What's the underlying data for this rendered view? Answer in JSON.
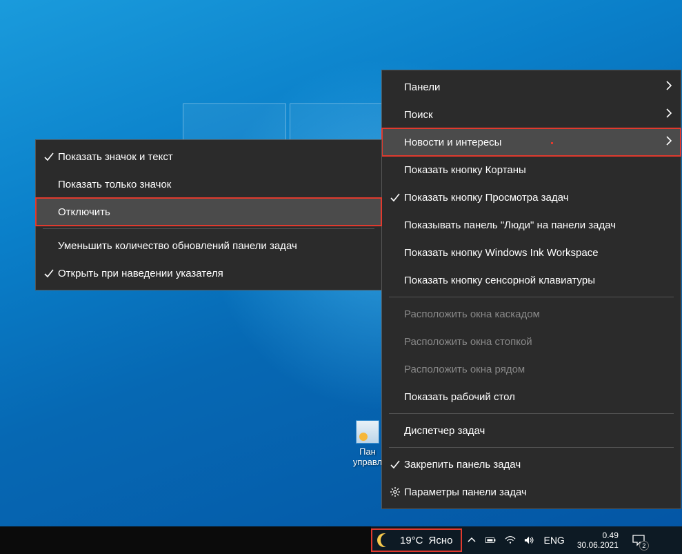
{
  "desktop": {
    "icon_label_line1": "Пан",
    "icon_label_line2": "управл"
  },
  "main_menu": {
    "items": [
      {
        "label": "Панели",
        "submenu": true,
        "checked": false,
        "gear": false,
        "disabled": false,
        "highlighted": false
      },
      {
        "label": "Поиск",
        "submenu": true,
        "checked": false,
        "gear": false,
        "disabled": false,
        "highlighted": false
      },
      {
        "label": "Новости и интересы",
        "submenu": true,
        "checked": false,
        "gear": false,
        "disabled": false,
        "highlighted": true
      },
      {
        "label": "Показать кнопку Кортаны",
        "submenu": false,
        "checked": false,
        "gear": false,
        "disabled": false,
        "highlighted": false
      },
      {
        "label": "Показать кнопку Просмотра задач",
        "submenu": false,
        "checked": true,
        "gear": false,
        "disabled": false,
        "highlighted": false
      },
      {
        "label": "Показывать панель \"Люди\" на панели задач",
        "submenu": false,
        "checked": false,
        "gear": false,
        "disabled": false,
        "highlighted": false
      },
      {
        "label": "Показать кнопку Windows Ink Workspace",
        "submenu": false,
        "checked": false,
        "gear": false,
        "disabled": false,
        "highlighted": false
      },
      {
        "label": "Показать кнопку сенсорной клавиатуры",
        "submenu": false,
        "checked": false,
        "gear": false,
        "disabled": false,
        "highlighted": false
      }
    ],
    "items2": [
      {
        "label": "Расположить окна каскадом",
        "submenu": false,
        "checked": false,
        "gear": false,
        "disabled": true,
        "highlighted": false
      },
      {
        "label": "Расположить окна стопкой",
        "submenu": false,
        "checked": false,
        "gear": false,
        "disabled": true,
        "highlighted": false
      },
      {
        "label": "Расположить окна рядом",
        "submenu": false,
        "checked": false,
        "gear": false,
        "disabled": true,
        "highlighted": false
      },
      {
        "label": "Показать рабочий стол",
        "submenu": false,
        "checked": false,
        "gear": false,
        "disabled": false,
        "highlighted": false
      }
    ],
    "items3": [
      {
        "label": "Диспетчер задач",
        "submenu": false,
        "checked": false,
        "gear": false,
        "disabled": false,
        "highlighted": false
      }
    ],
    "items4": [
      {
        "label": "Закрепить панель задач",
        "submenu": false,
        "checked": true,
        "gear": false,
        "disabled": false,
        "highlighted": false
      },
      {
        "label": "Параметры панели задач",
        "submenu": false,
        "checked": false,
        "gear": true,
        "disabled": false,
        "highlighted": false
      }
    ]
  },
  "sub_menu": {
    "items": [
      {
        "label": "Показать значок и текст",
        "checked": true,
        "highlighted": false
      },
      {
        "label": "Показать только значок",
        "checked": false,
        "highlighted": false
      },
      {
        "label": "Отключить",
        "checked": false,
        "highlighted": true
      }
    ],
    "items2": [
      {
        "label": "Уменьшить количество обновлений панели задач",
        "checked": false,
        "highlighted": false
      },
      {
        "label": "Открыть при наведении указателя",
        "checked": true,
        "highlighted": false
      }
    ]
  },
  "taskbar": {
    "weather_temp": "19°C",
    "weather_text": "Ясно",
    "lang": "ENG",
    "time": "0.49",
    "date": "30.06.2021",
    "notif_count": "2"
  }
}
